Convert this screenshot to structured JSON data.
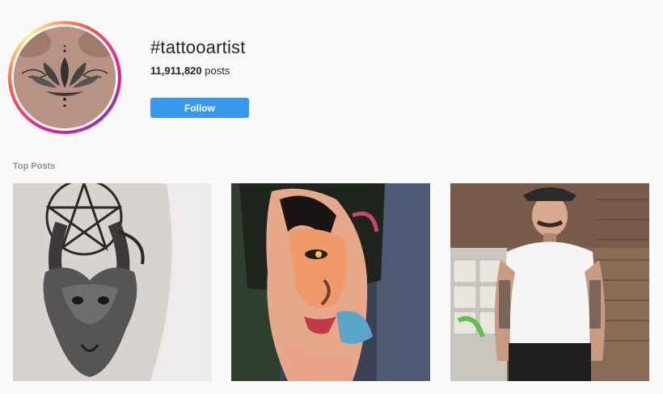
{
  "header": {
    "hashtag": "#tattooartist",
    "post_count": "11,911,820",
    "post_count_suffix": " posts",
    "follow_label": "Follow"
  },
  "top_posts": {
    "label": "Top Posts",
    "items": [
      {
        "subject": "goat-skull-pentagram-tattoo"
      },
      {
        "subject": "colored-face-hand-tattoo"
      },
      {
        "subject": "tattooed-man-white-tshirt"
      }
    ]
  },
  "colors": {
    "accent": "#3897f0",
    "background": "#fafafa",
    "muted_text": "#8e8e8e"
  }
}
